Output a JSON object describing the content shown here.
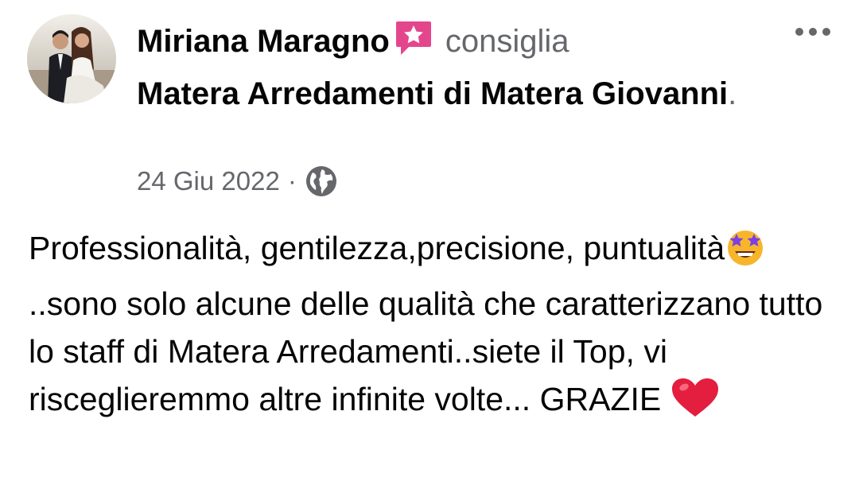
{
  "post": {
    "author": "Miriana Maragno",
    "verb": "consiglia",
    "page_name": "Matera Arredamenti di Matera Giovanni",
    "punct": ".",
    "date": "24 Giu 2022",
    "separator": "·",
    "privacy_icon": "globe-icon",
    "badge_icon": "recommend-star-icon",
    "more_icon": "more-horizontal-icon",
    "text_part1": "Professionalità, gentilezza,precisione, puntualità",
    "emoji1": "star-struck-emoji",
    "text_part2": "..sono solo alcune delle qualità che caratterizzano tutto lo staff di Matera Arredamenti..siete il Top, vi risceglieremmo altre infinite volte... GRAZIE ",
    "emoji2": "red-heart-emoji"
  },
  "colors": {
    "text_primary": "#050505",
    "text_secondary": "#65676b",
    "badge": "#e4468d",
    "heart": "#e41e3f"
  }
}
